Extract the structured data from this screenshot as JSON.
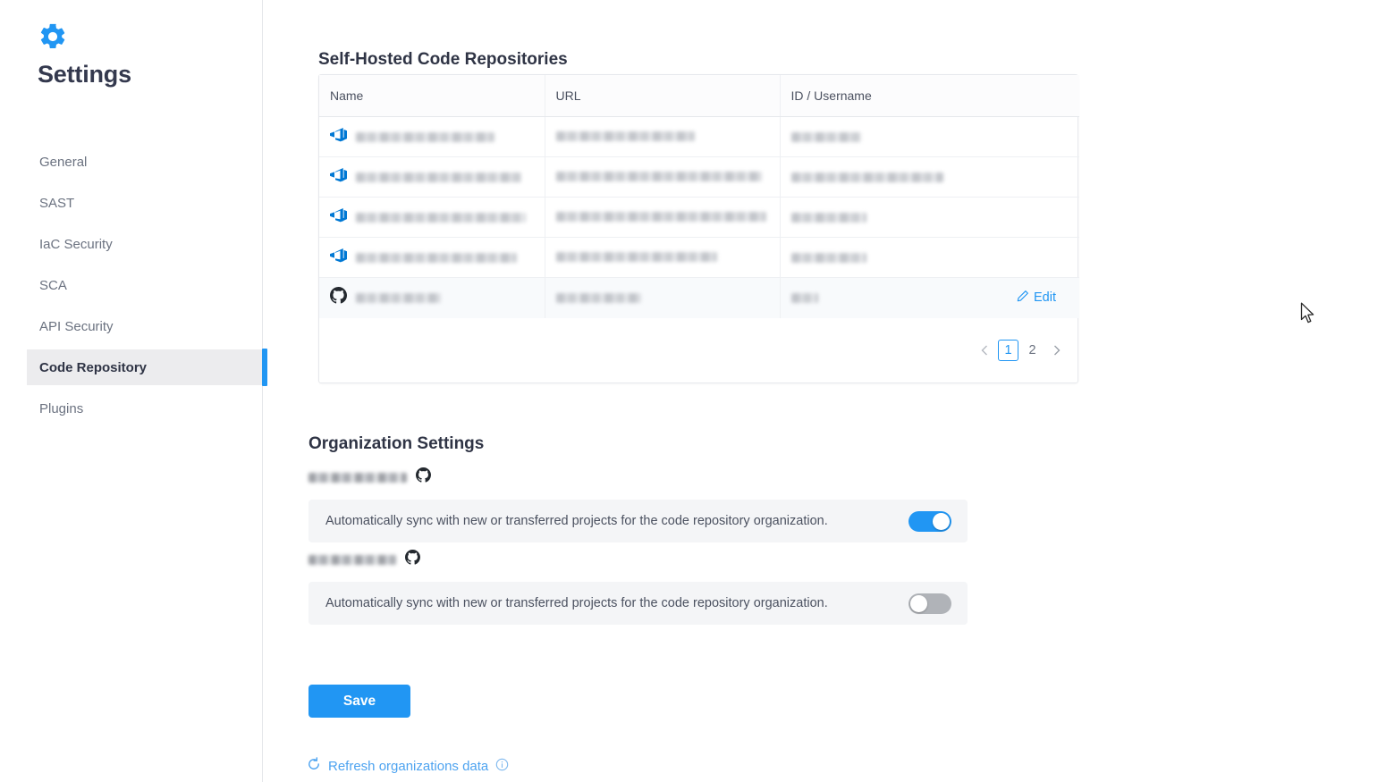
{
  "sidebar": {
    "brand_title": "Settings",
    "logo_icon": "gear-icon",
    "items": [
      {
        "label": "General",
        "active": false
      },
      {
        "label": "SAST",
        "active": false
      },
      {
        "label": "IaC Security",
        "active": false
      },
      {
        "label": "SCA",
        "active": false
      },
      {
        "label": "API Security",
        "active": false
      },
      {
        "label": "Code Repository",
        "active": true
      },
      {
        "label": "Plugins",
        "active": false
      }
    ]
  },
  "repositories_section": {
    "title": "Self-Hosted Code Repositories",
    "columns": [
      "Name",
      "URL",
      "ID / Username"
    ],
    "rows": [
      {
        "provider_icon": "azure-devops-icon",
        "name": "[redacted]",
        "url": "[redacted]",
        "id_username": "[redacted]",
        "name_w": 155,
        "url_w": 155,
        "id_w": 78,
        "action": null
      },
      {
        "provider_icon": "azure-devops-icon",
        "name": "[redacted]",
        "url": "[redacted]",
        "id_username": "[redacted]",
        "name_w": 185,
        "url_w": 230,
        "id_w": 170,
        "action": null
      },
      {
        "provider_icon": "azure-devops-icon",
        "name": "[redacted]",
        "url": "[redacted]",
        "id_username": "[redacted]",
        "name_w": 190,
        "url_w": 235,
        "id_w": 84,
        "action": null
      },
      {
        "provider_icon": "azure-devops-icon",
        "name": "[redacted]",
        "url": "[redacted]",
        "id_username": "[redacted]",
        "name_w": 180,
        "url_w": 180,
        "id_w": 84,
        "action": null
      },
      {
        "provider_icon": "github-icon",
        "name": "[redacted]",
        "url": "[redacted]",
        "id_username": "[redacted]",
        "name_w": 95,
        "url_w": 95,
        "id_w": 30,
        "action": "Edit"
      }
    ],
    "edit_label": "Edit",
    "edit_icon": "pencil-icon",
    "pagination": {
      "prev_icon": "chevron-left-icon",
      "next_icon": "chevron-right-icon",
      "pages": [
        "1",
        "2"
      ],
      "active_page": "1"
    }
  },
  "organization_section": {
    "title": "Organization Settings",
    "organizations": [
      {
        "name": "[redacted]",
        "name_w": 110,
        "provider_icon": "github-icon",
        "sync_label": "Automatically sync with new or transferred projects for the code repository organization.",
        "sync_enabled": true
      },
      {
        "name": "[redacted]",
        "name_w": 98,
        "provider_icon": "github-icon",
        "sync_label": "Automatically sync with new or transferred projects for the code repository organization.",
        "sync_enabled": false
      }
    ]
  },
  "footer": {
    "save_label": "Save",
    "refresh_label": "Refresh organizations data",
    "refresh_icon": "refresh-icon",
    "info_icon": "info-circle-icon"
  },
  "colors": {
    "accent": "#2196f3",
    "accent_light": "#4da3f0",
    "text_dark": "#2f3445",
    "text_muted": "#6b7280",
    "panel_bg": "#f4f5f7",
    "active_nav_bg": "#ececee"
  }
}
